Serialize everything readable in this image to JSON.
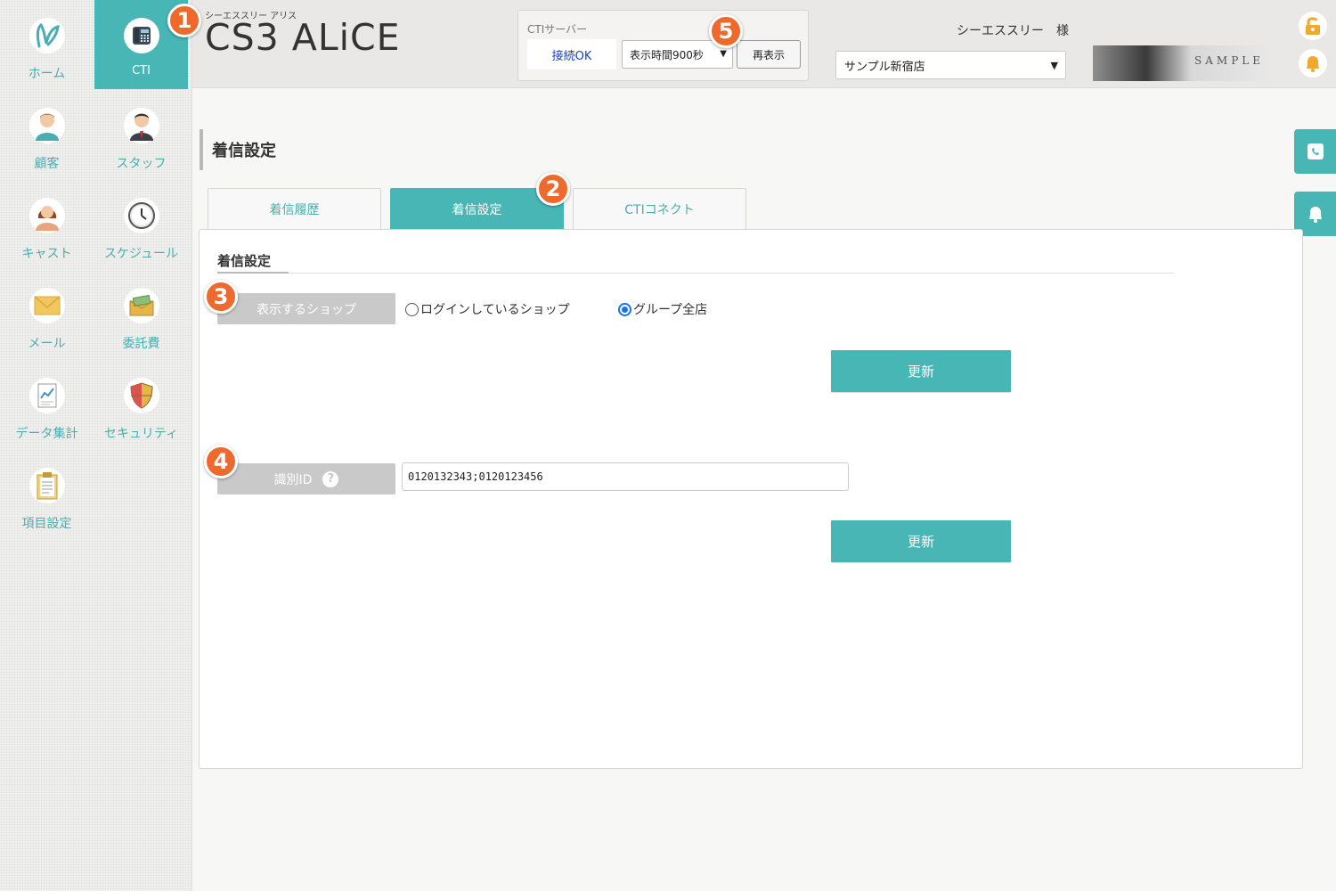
{
  "header": {
    "logo_sub": "シーエススリー アリス",
    "logo_main": "CS3 ALiCE",
    "cti_server_label": "CTIサーバー",
    "cti_status": "接続OK",
    "display_time_select": "表示時間900秒",
    "refresh_button": "再表示",
    "user_name": "シーエススリー　様",
    "shop_select": "サンプル新宿店",
    "banner_text": "SAMPLE"
  },
  "sidebar": {
    "items": [
      {
        "label": "ホーム",
        "icon": "bunny-logo-icon"
      },
      {
        "label": "CTI",
        "icon": "telephone-icon"
      },
      {
        "label": "顧客",
        "icon": "customer-icon"
      },
      {
        "label": "スタッフ",
        "icon": "staff-icon"
      },
      {
        "label": "キャスト",
        "icon": "cast-icon"
      },
      {
        "label": "スケジュール",
        "icon": "clock-icon"
      },
      {
        "label": "メール",
        "icon": "mail-icon"
      },
      {
        "label": "委託費",
        "icon": "money-icon"
      },
      {
        "label": "データ集計",
        "icon": "report-icon"
      },
      {
        "label": "セキュリティ",
        "icon": "shield-icon"
      },
      {
        "label": "項目設定",
        "icon": "clipboard-icon"
      }
    ]
  },
  "main": {
    "page_title": "着信設定",
    "tabs": [
      {
        "label": "着信履歴"
      },
      {
        "label": "着信設定"
      },
      {
        "label": "CTIコネクト"
      }
    ],
    "section_title": "着信設定",
    "shop_display_label": "表示するショップ",
    "radio_options": [
      {
        "label": "ログインしているショップ",
        "selected": false
      },
      {
        "label": "グループ全店",
        "selected": true
      }
    ],
    "update_button_1": "更新",
    "identifier_label": "識別ID",
    "identifier_help": "?",
    "identifier_value": "0120132343;0120123456",
    "update_button_2": "更新"
  },
  "badges": [
    "1",
    "2",
    "3",
    "4",
    "5"
  ],
  "colors": {
    "accent": "#47b6b5",
    "badge": "#ee6a2c",
    "label_bg": "#c9c9c9",
    "status_text": "#1a3fd1"
  }
}
